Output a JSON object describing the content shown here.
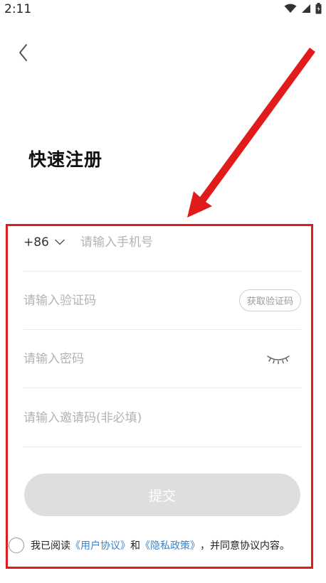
{
  "status_bar": {
    "time": "2:11",
    "icons": [
      "wifi-icon",
      "signal-icon",
      "battery-icon"
    ]
  },
  "header": {
    "back_icon": "chevron-left-icon",
    "title": "快速注册"
  },
  "form": {
    "country_code": "+86",
    "phone_placeholder": "请输入手机号",
    "code_placeholder": "请输入验证码",
    "get_code_label": "获取验证码",
    "password_placeholder": "请输入密码",
    "password_toggle_icon": "eye-closed-icon",
    "invite_placeholder": "请输入邀请码(非必填)",
    "submit_label": "提交"
  },
  "agreement": {
    "prefix": "我已阅读",
    "user_agreement": "《用户协议》",
    "and": "和",
    "privacy_policy": "《隐私政策》",
    "suffix": "，并同意协议内容。"
  },
  "colors": {
    "link": "#3d83c6",
    "annotation_red": "#e11b1b",
    "submit_disabled": "#dedede"
  }
}
